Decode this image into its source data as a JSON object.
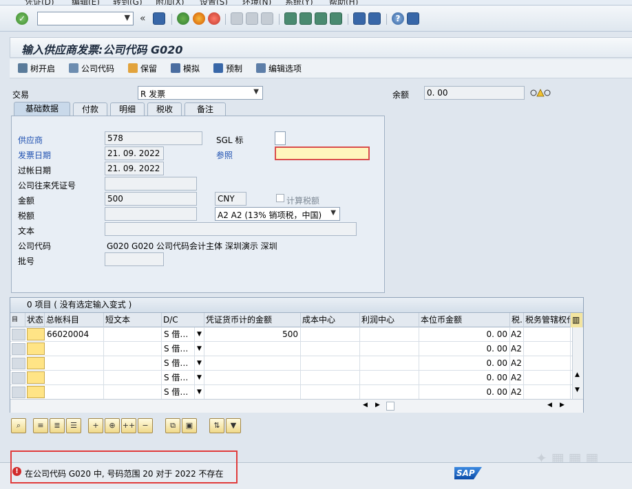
{
  "window": {
    "title": "输入供应商发票:公司代码 G020"
  },
  "menu": [
    "凭证(D)",
    "编辑(E)",
    "转到(G)",
    "附加(X)",
    "设置(S)",
    "环境(N)",
    "系统(Y)",
    "帮助(H)"
  ],
  "app_toolbar": [
    "树开启",
    "公司代码",
    "保留",
    "模拟",
    "预制",
    "编辑选项"
  ],
  "header": {
    "transaction_label": "交易",
    "transaction_value": "R 发票",
    "balance_label": "余额",
    "balance_value": "0. 00"
  },
  "tabs": [
    "基础数据",
    "付款",
    "明细",
    "税收",
    "备注"
  ],
  "basic": {
    "vendor_label": "供应商",
    "vendor_value": "578",
    "sgl_label": "SGL 标",
    "invoice_date_label": "发票日期",
    "invoice_date_value": "21. 09. 2022",
    "reference_label": "参照",
    "posting_date_label": "过帐日期",
    "posting_date_value": "21. 09. 2022",
    "cc_doc_label": "公司往来凭证号",
    "amount_label": "金额",
    "amount_value": "500",
    "currency": "CNY",
    "calc_tax_label": "计算税额",
    "tax_label": "税额",
    "tax_code": "A2 A2 (13% 销项税，中国)",
    "text_label": "文本",
    "company_code_label": "公司代码",
    "company_code_value": "G020 G020 公司代码会计主体 深圳演示 深圳",
    "batch_label": "批号"
  },
  "grid": {
    "title": "0 项目 ( 没有选定输入变式 )",
    "columns": [
      "状态",
      "总帐科目",
      "短文本",
      "D/C",
      "凭证货币计的金额",
      "成本中心",
      "利润中心",
      "本位币金额",
      "税.",
      "税务管辖权代码"
    ],
    "rows": [
      {
        "gl": "66020004",
        "dc": "S 借…",
        "amount": "500",
        "local": "0. 00",
        "tax": "A2"
      },
      {
        "gl": "",
        "dc": "S 借…",
        "amount": "",
        "local": "0. 00",
        "tax": "A2"
      },
      {
        "gl": "",
        "dc": "S 借…",
        "amount": "",
        "local": "0. 00",
        "tax": "A2"
      },
      {
        "gl": "",
        "dc": "S 借…",
        "amount": "",
        "local": "0. 00",
        "tax": "A2"
      },
      {
        "gl": "",
        "dc": "S 借…",
        "amount": "",
        "local": "0. 00",
        "tax": "A2"
      }
    ]
  },
  "status": {
    "message": "在公司代码 G020 中, 号码范围 20 对于 2022 不存在"
  },
  "colors": {
    "accent": "#1d4fb0",
    "error": "#d12b2b",
    "required": "#fff6bd"
  }
}
